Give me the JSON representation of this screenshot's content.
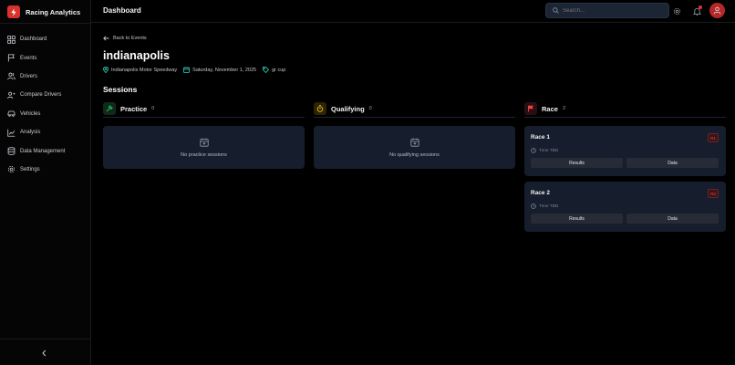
{
  "app": {
    "title": "Racing Analytics"
  },
  "sidebar": {
    "items": [
      {
        "label": "Dashboard",
        "icon": "dashboard-icon"
      },
      {
        "label": "Events",
        "icon": "flag-icon"
      },
      {
        "label": "Drivers",
        "icon": "users-icon"
      },
      {
        "label": "Compare Drivers",
        "icon": "compare-users-icon"
      },
      {
        "label": "Vehicles",
        "icon": "car-icon"
      },
      {
        "label": "Analysis",
        "icon": "chart-line-icon"
      },
      {
        "label": "Data Management",
        "icon": "database-icon"
      },
      {
        "label": "Settings",
        "icon": "gear-icon"
      }
    ]
  },
  "header": {
    "title": "Dashboard",
    "search_placeholder": "Search..."
  },
  "event": {
    "back_label": "Back to Events",
    "title": "indianapolis",
    "venue": "Indianapolis Motor Speedway",
    "date": "Saturday, November 1, 2025",
    "series": "gr cup"
  },
  "sessions": {
    "heading": "Sessions",
    "practice": {
      "title": "Practice",
      "count": "0",
      "empty_text": "No practice sessions"
    },
    "qualifying": {
      "title": "Qualifying",
      "count": "0",
      "empty_text": "No qualifying sessions"
    },
    "race": {
      "title": "Race",
      "count": "2",
      "items": [
        {
          "name": "Race 1",
          "badge": "R1",
          "time": "Time TBD",
          "results_label": "Results",
          "data_label": "Data"
        },
        {
          "name": "Race 2",
          "badge": "R2",
          "time": "Time TBD",
          "results_label": "Results",
          "data_label": "Data"
        }
      ]
    }
  },
  "colors": {
    "accent_red": "#d9322c",
    "practice_green": "#22c55e",
    "qualifying_yellow": "#eab308",
    "race_red": "#ef4444",
    "meta_teal": "#2dd4bf"
  }
}
